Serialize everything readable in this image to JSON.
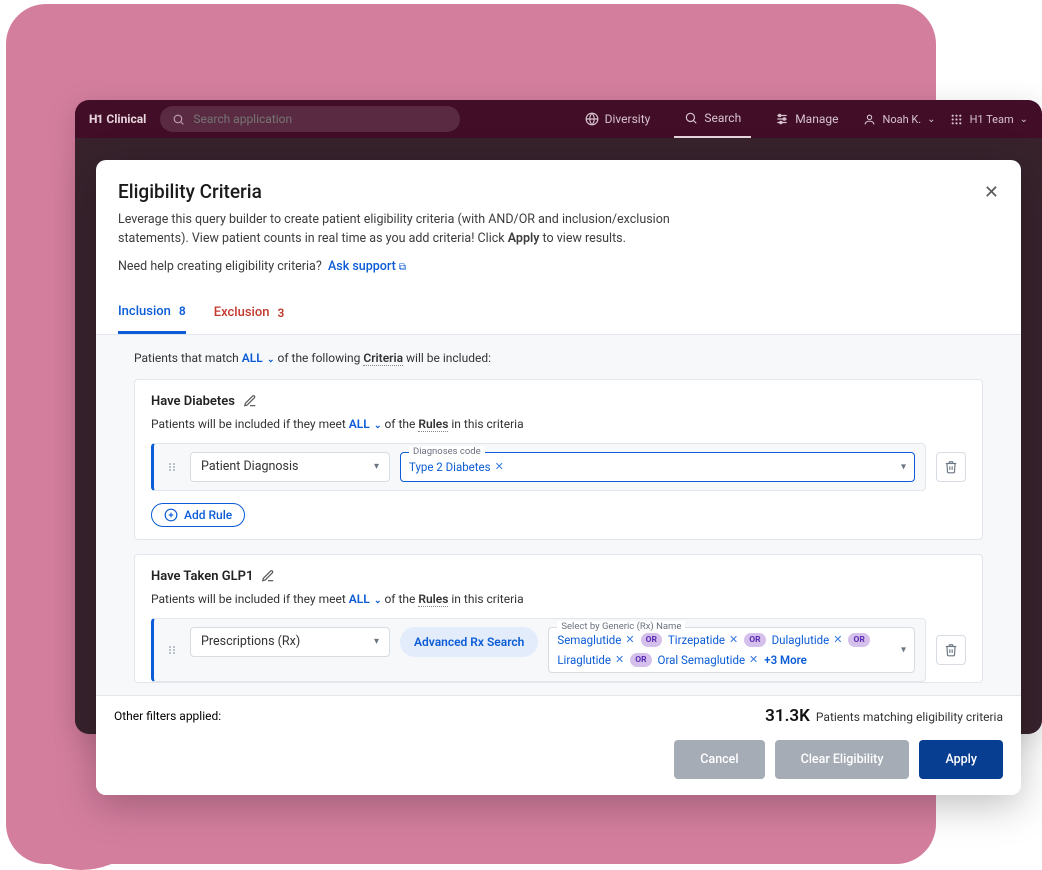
{
  "topbar": {
    "brand_mark": "H1",
    "brand_name": "Clinical",
    "search_placeholder": "Search application",
    "nav": {
      "diversity": "Diversity",
      "search": "Search",
      "manage": "Manage"
    },
    "user_name": "Noah K.",
    "team_name": "H1 Team"
  },
  "modal": {
    "title": "Eligibility Criteria",
    "description_pre": "Leverage this query builder to create patient eligibility criteria (with AND/OR and inclusion/exclusion statements). View patient counts in real time as you add criteria! Click ",
    "description_bold": "Apply",
    "description_post": " to view results.",
    "help_prefix": "Need help creating eligibility criteria?",
    "help_link": "Ask support"
  },
  "tabs": {
    "inclusion_label": "Inclusion",
    "inclusion_count": "8",
    "exclusion_label": "Exclusion",
    "exclusion_count": "3"
  },
  "match_line": {
    "pre": "Patients that match ",
    "all": "ALL",
    "mid": " of the following ",
    "criteria_word": "Criteria",
    "post": " will be included:"
  },
  "card1": {
    "title": "Have Diabetes",
    "match_pre": "Patients will be included if they meet ",
    "match_all": "ALL",
    "match_mid": " of the ",
    "match_rules": "Rules",
    "match_post": " in this criteria",
    "select_label": "Patient Diagnosis",
    "chip_field_label": "Diagnoses code",
    "chip1": "Type 2 Diabetes",
    "add_rule": "Add Rule"
  },
  "card2": {
    "title": "Have Taken GLP1",
    "match_pre": "Patients will be included if they meet ",
    "match_all": "ALL",
    "match_mid": " of the ",
    "match_rules": "Rules",
    "match_post": " in this criteria",
    "select_label": "Prescriptions (Rx)",
    "adv_search": "Advanced Rx Search",
    "chip_field_label": "Select by Generic (Rx) Name",
    "chips": {
      "c1": "Semaglutide",
      "c2": "Tirzepatide",
      "c3": "Dulaglutide",
      "c4": "Liraglutide",
      "c5": "Oral Semaglutide"
    },
    "or": "OR",
    "more": "+3 More"
  },
  "footer": {
    "other_filters": "Other filters applied:",
    "count": "31.3K",
    "matching": "Patients matching eligibility criteria",
    "cancel": "Cancel",
    "clear": "Clear Eligibility",
    "apply": "Apply"
  }
}
